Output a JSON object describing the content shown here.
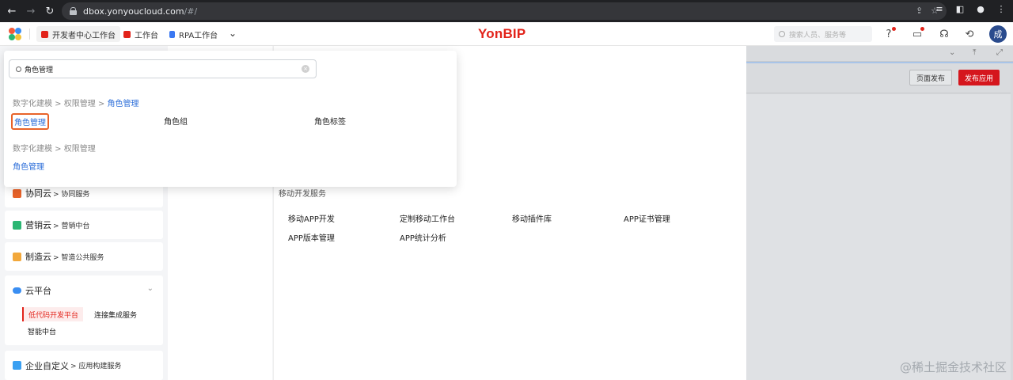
{
  "browser": {
    "url_host": "dbox.yonyoucloud.com",
    "url_rest": "/#/"
  },
  "header": {
    "tabs": [
      {
        "label": "开发者中心工作台",
        "color": "#e2231a"
      },
      {
        "label": "工作台",
        "color": "#e2231a"
      },
      {
        "label": "RPA工作台",
        "color": "#3a78f2"
      }
    ],
    "brand_a": "Yon",
    "brand_b": "BIP",
    "search_placeholder": "搜索人员、服务等",
    "avatar_text": "成"
  },
  "search_popup": {
    "query": "角色管理",
    "groups": [
      {
        "crumb_prefix": "数字化建模 > 权限管理 > ",
        "crumb_current": "角色管理",
        "items": [
          "角色管理",
          "角色组",
          "角色标签"
        ]
      },
      {
        "crumb_prefix": "数字化建模 > 权限管理",
        "crumb_current": "",
        "items": [
          "角色管理"
        ]
      }
    ]
  },
  "left_panel": {
    "clouds": [
      {
        "name": "协同云",
        "sub": "> 协同服务",
        "color": "#e8632a"
      },
      {
        "name": "营销云",
        "sub": "> 营销中台",
        "color": "#2bb673"
      },
      {
        "name": "制造云",
        "sub": "> 智造公共服务",
        "color": "#f2a83b"
      }
    ],
    "platform": {
      "name": "云平台",
      "active_chip": "低代码开发平台",
      "chip_2": "连接集成服务",
      "chip_3": "智能中台"
    },
    "enterprise": {
      "name": "企业自定义",
      "sub": "> 应用构建服务"
    }
  },
  "main": {
    "section_title": "移动开发服务",
    "services": [
      "移动APP开发",
      "定制移动工作台",
      "移动插件库",
      "APP证书管理",
      "APP版本管理",
      "APP统计分析"
    ]
  },
  "right_panel": {
    "page_publish": "页面发布",
    "publish_app": "发布应用"
  },
  "watermark": "@稀土掘金技术社区"
}
